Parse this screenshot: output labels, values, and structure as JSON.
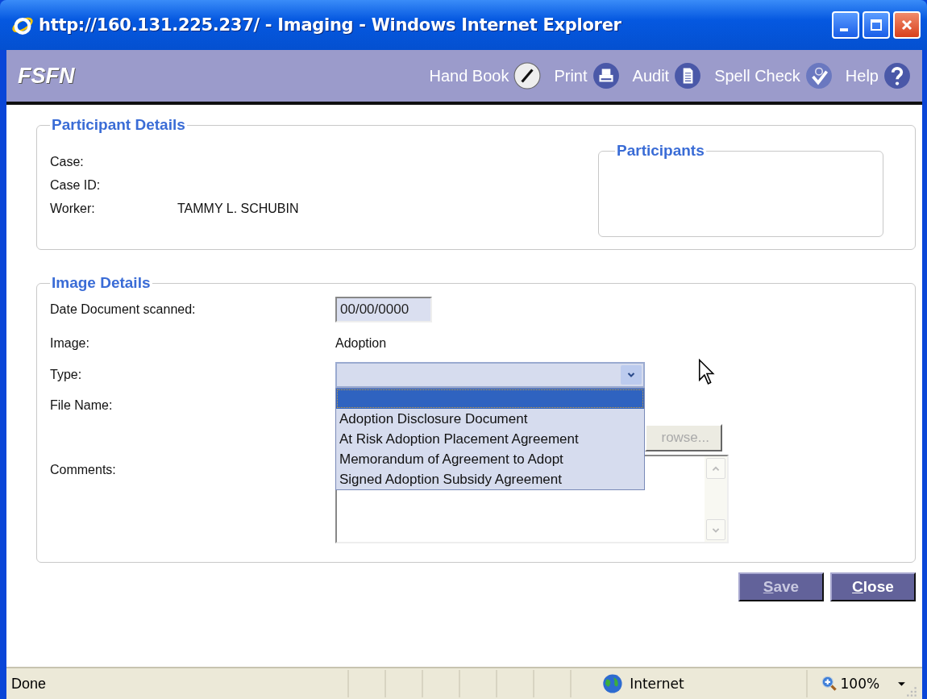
{
  "window": {
    "title": "http://160.131.225.237/ - Imaging - Windows Internet Explorer"
  },
  "app_bar": {
    "logo": "FSFN",
    "tools": [
      {
        "label": "Hand Book",
        "kind": "pencil"
      },
      {
        "label": "Print",
        "kind": "printer"
      },
      {
        "label": "Audit",
        "kind": "document"
      },
      {
        "label": "Spell Check",
        "kind": "spellcheck"
      },
      {
        "label": "Help",
        "kind": "help"
      }
    ]
  },
  "participant_details": {
    "legend": "Participant Details",
    "fields": [
      {
        "label": "Case:"
      },
      {
        "label": "Case ID:"
      },
      {
        "label": "Worker:",
        "value": "TAMMY L. SCHUBIN"
      }
    ],
    "participants": {
      "legend": "Participants"
    }
  },
  "image_details": {
    "legend": "Image Details",
    "date_scanned": {
      "label": "Date Document scanned:",
      "value": "00/00/0000"
    },
    "image": {
      "label": "Image:",
      "value": "Adoption"
    },
    "type": {
      "label": "Type:",
      "expanded": true,
      "options": [
        {
          "selected": true
        },
        {
          "label": "Adoption Disclosure Document",
          "selected": false
        },
        {
          "label": "At Risk Adoption Placement Agreement",
          "selected": false
        },
        {
          "label": "Memorandum of Agreement to Adopt",
          "selected": false
        },
        {
          "label": "Signed Adoption Subsidy Agreement",
          "selected": false
        }
      ]
    },
    "file_name": {
      "label": "File Name:",
      "browse": "rowse..."
    },
    "comments": {
      "label": "Comments:"
    }
  },
  "buttons": [
    {
      "label": "Save",
      "disabled": true
    },
    {
      "label": "Close",
      "disabled": false
    }
  ],
  "status_bar": {
    "text": "Done",
    "zone": "Internet",
    "zoom": "100%"
  }
}
